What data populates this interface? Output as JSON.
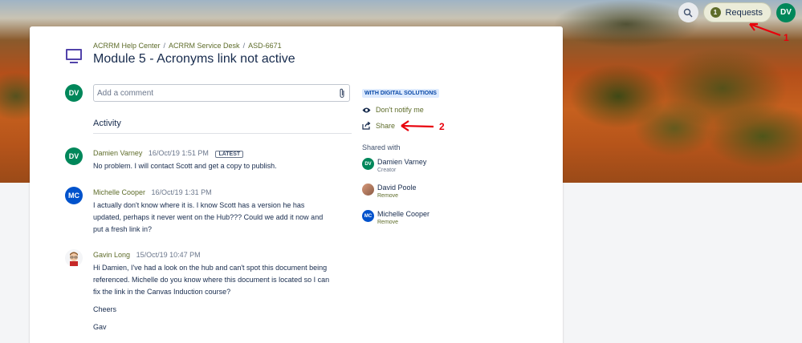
{
  "header": {
    "requests_label": "Requests",
    "requests_count": "1",
    "user_initials": "DV"
  },
  "issue": {
    "breadcrumb": [
      "ACRRM Help Center",
      "ACRRM Service Desk",
      "ASD-6671"
    ],
    "title": "Module 5 - Acronyms link not active"
  },
  "comment": {
    "avatar_initials": "DV",
    "placeholder": "Add a comment"
  },
  "activity": {
    "heading": "Activity",
    "entries": [
      {
        "initials": "DV",
        "name": "Damien Varney",
        "time": "16/Oct/19 1:51 PM",
        "badge": "LATEST",
        "paragraphs": [
          "No problem. I will contact Scott and get a copy to publish."
        ]
      },
      {
        "initials": "MC",
        "name": "Michelle Cooper",
        "time": "16/Oct/19 1:31 PM",
        "paragraphs": [
          "I actually don't know where it is. I know Scott has a version he has updated, perhaps it never went on the Hub??? Could we add it now and put a fresh link in?"
        ]
      },
      {
        "name": "Gavin Long",
        "time": "15/Oct/19 10:47 PM",
        "paragraphs": [
          "Hi Damien, I've had a look on the hub and can't spot this document being referenced. Michelle do you know where this document is located so I can fix the link in the Canvas Induction course?",
          "Cheers",
          "Gav"
        ]
      }
    ]
  },
  "sidebar": {
    "status": "WITH DIGITAL SOLUTIONS",
    "notify_label": "Don't notify me",
    "share_label": "Share",
    "shared_with_heading": "Shared with",
    "participants": [
      {
        "initials": "DV",
        "name": "Damien Varney",
        "sub": "Creator"
      },
      {
        "initials": "",
        "name": "David Poole",
        "sub": "Remove"
      },
      {
        "initials": "MC",
        "name": "Michelle Cooper",
        "sub": "Remove"
      }
    ]
  },
  "annotations": {
    "arrow_1_label": "1",
    "arrow_2_label": "2",
    "color": "#e8000b"
  },
  "colors": {
    "accent_green": "#00875a",
    "accent_blue": "#0052cc",
    "link_olive": "#5e6c2a"
  }
}
